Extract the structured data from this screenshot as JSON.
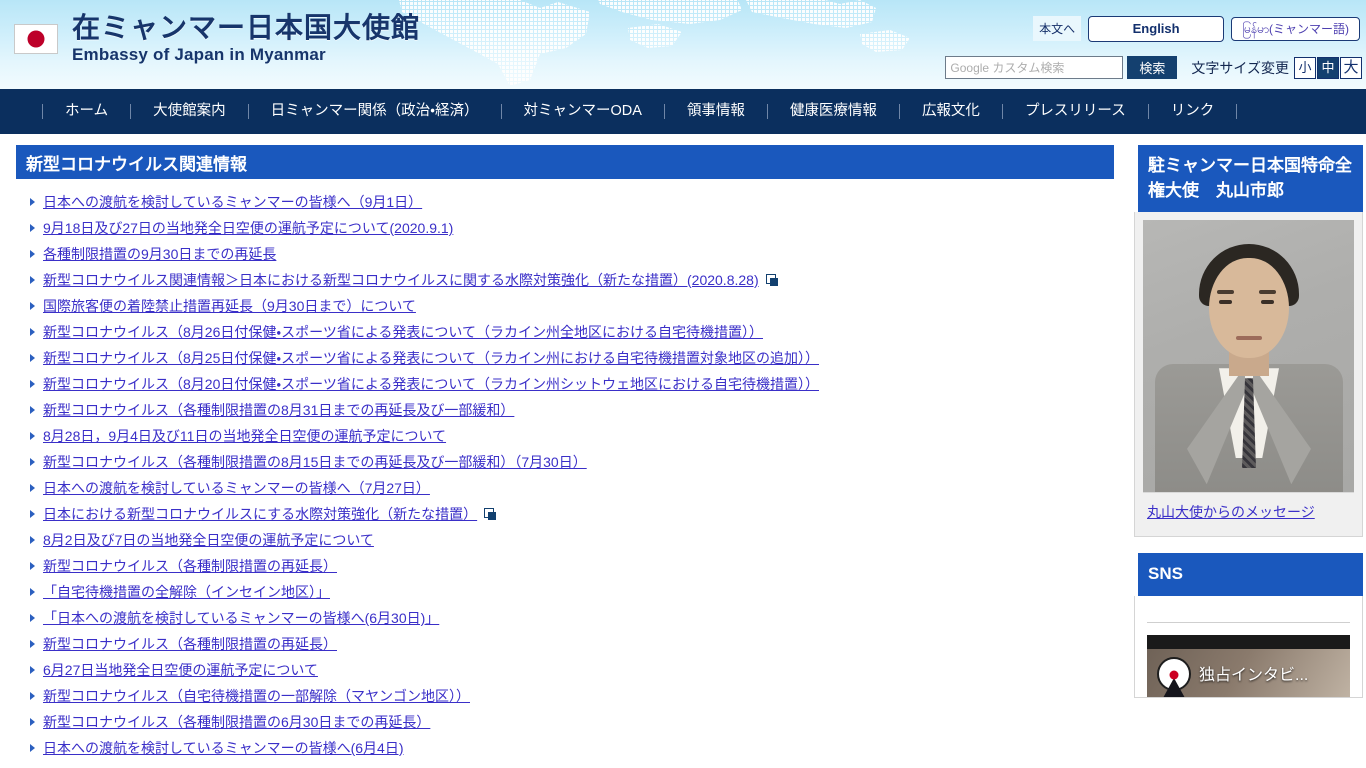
{
  "header": {
    "flag_icon": "japan-flag-icon",
    "title_jp": "在ミャンマー日本国大使館",
    "title_en": "Embassy of Japan in Myanmar",
    "skip_link": "本文へ",
    "lang_english": "English",
    "lang_myanmar": "မြန်မာ(ミャンマー語)",
    "search": {
      "placeholder": "Google カスタム検索",
      "value": "",
      "button": "検索"
    },
    "font_size": {
      "label": "文字サイズ変更",
      "options": [
        "小",
        "中",
        "大"
      ],
      "selected": "中"
    }
  },
  "nav": {
    "items": [
      {
        "label": "ホーム"
      },
      {
        "label": "大使館案内"
      },
      {
        "label": "日ミャンマー関係（政治・経済）"
      },
      {
        "label": "対ミャンマーODA"
      },
      {
        "label": "領事情報"
      },
      {
        "label": "健康医療情報"
      },
      {
        "label": "広報文化"
      },
      {
        "label": "プレスリリース"
      },
      {
        "label": "リンク"
      }
    ]
  },
  "main": {
    "section_title": "新型コロナウイルス関連情報",
    "links": [
      {
        "label": "日本への渡航を検討しているミャンマーの皆様へ（9月1日）",
        "external": false
      },
      {
        "label": "9月18日及び27日の当地発全日空便の運航予定について(2020.9.1)",
        "external": false
      },
      {
        "label": "各種制限措置の9月30日までの再延長",
        "external": false
      },
      {
        "label": "新型コロナウイルス関連情報＞日本における新型コロナウイルスに関する水際対策強化（新たな措置）(2020.8.28)",
        "external": true
      },
      {
        "label": "国際旅客便の着陸禁止措置再延長（9月30日まで）について",
        "external": false
      },
      {
        "label": "新型コロナウイルス（8月26日付保健・スポーツ省による発表について（ラカイン州全地区における自宅待機措置））",
        "external": false
      },
      {
        "label": "新型コロナウイルス（8月25日付保健・スポーツ省による発表について（ラカイン州における自宅待機措置対象地区の追加））",
        "external": false
      },
      {
        "label": "新型コロナウイルス（8月20日付保健・スポーツ省による発表について（ラカイン州シットウェ地区における自宅待機措置））",
        "external": false
      },
      {
        "label": "新型コロナウイルス（各種制限措置の8月31日までの再延長及び一部緩和）",
        "external": false
      },
      {
        "label": "8月28日，9月4日及び11日の当地発全日空便の運航予定について",
        "external": false
      },
      {
        "label": "新型コロナウイルス（各種制限措置の8月15日までの再延長及び一部緩和）（7月30日）",
        "external": false
      },
      {
        "label": "日本への渡航を検討しているミャンマーの皆様へ（7月27日）",
        "external": false
      },
      {
        "label": "日本における新型コロナウイルスにする水際対策強化（新たな措置）",
        "external": true
      },
      {
        "label": "8月2日及び7日の当地発全日空便の運航予定について",
        "external": false
      },
      {
        "label": "新型コロナウイルス（各種制限措置の再延長）",
        "external": false
      },
      {
        "label": "「自宅待機措置の全解除（インセイン地区）」",
        "external": false
      },
      {
        "label": "「日本への渡航を検討しているミャンマーの皆様へ(6月30日)」",
        "external": false
      },
      {
        "label": "新型コロナウイルス（各種制限措置の再延長）",
        "external": false
      },
      {
        "label": "6月27日当地発全日空便の運航予定について",
        "external": false
      },
      {
        "label": "新型コロナウイルス（自宅待機措置の一部解除（マヤンゴン地区））",
        "external": false
      },
      {
        "label": "新型コロナウイルス（各種制限措置の6月30日までの再延長）",
        "external": false
      },
      {
        "label": "日本への渡航を検討しているミャンマーの皆様へ(6月4日)",
        "external": false
      }
    ]
  },
  "sidebar": {
    "ambassador": {
      "title": "駐ミャンマー日本国特命全権大使　丸山市郎",
      "photo_alt": "ambassador-photo",
      "message_link": "丸山大使からのメッセージ"
    },
    "sns": {
      "title": "SNS",
      "video_title": "独占インタビ...",
      "video_logo": "embassy-logo-icon"
    }
  },
  "colors": {
    "nav_bg": "#0b2f5e",
    "heading_blue": "#1a58bd",
    "link": "#3a2fc8",
    "header_gradient_top": "#b8e6f7"
  }
}
